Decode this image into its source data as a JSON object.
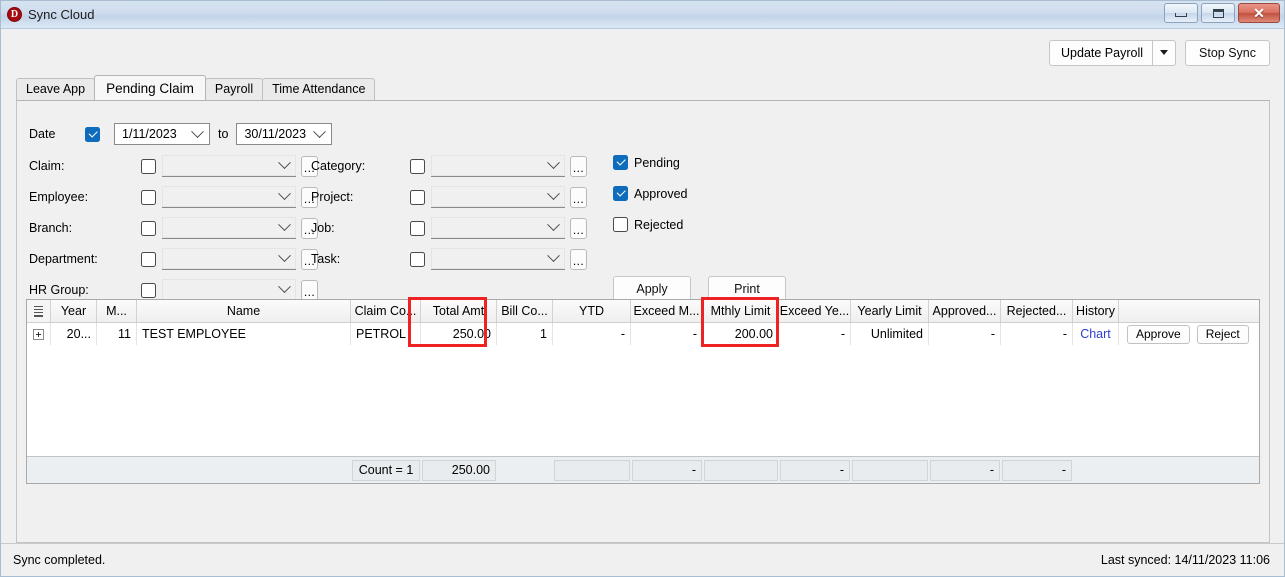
{
  "window": {
    "title": "Sync Cloud",
    "logo_letter": "D",
    "controls": [
      {
        "name": "minimize",
        "label": "Minimize"
      },
      {
        "name": "maximize",
        "label": "Maximize"
      },
      {
        "name": "close",
        "label": "✕"
      }
    ]
  },
  "toolbar": {
    "update_payroll_label": "Update Payroll",
    "stop_sync_label": "Stop Sync"
  },
  "tabs": [
    {
      "label": "Leave App",
      "active": false
    },
    {
      "label": "Pending Claim",
      "active": true
    },
    {
      "label": "Payroll",
      "active": false
    },
    {
      "label": "Time Attendance",
      "active": false
    }
  ],
  "filters": {
    "date": {
      "label": "Date",
      "checked": true,
      "from": "1/11/2023",
      "to_label": "to",
      "to": "30/11/2023"
    },
    "left_column": [
      {
        "label": "Claim:",
        "checked": false,
        "value": "",
        "has_browse": true
      },
      {
        "label": "Employee:",
        "checked": false,
        "value": "",
        "has_browse": true
      },
      {
        "label": "Branch:",
        "checked": false,
        "value": "",
        "has_browse": true
      },
      {
        "label": "Department:",
        "checked": false,
        "value": "",
        "has_browse": true
      },
      {
        "label": "HR Group:",
        "checked": false,
        "value": "",
        "has_browse": true
      }
    ],
    "right_column": [
      {
        "label": "Category:",
        "checked": false,
        "value": "",
        "has_browse": true
      },
      {
        "label": "Project:",
        "checked": false,
        "value": "",
        "has_browse": true
      },
      {
        "label": "Job:",
        "checked": false,
        "value": "",
        "has_browse": true
      },
      {
        "label": "Task:",
        "checked": false,
        "value": "",
        "has_browse": true
      }
    ],
    "status": [
      {
        "label": "Pending",
        "checked": true
      },
      {
        "label": "Approved",
        "checked": true
      },
      {
        "label": "Rejected",
        "checked": false
      }
    ],
    "apply_label": "Apply",
    "print_label": "Print"
  },
  "grid": {
    "columns": [
      {
        "key": "year",
        "label": "Year"
      },
      {
        "key": "month",
        "label": "M..."
      },
      {
        "key": "name",
        "label": "Name"
      },
      {
        "key": "claim_code",
        "label": "Claim Co..."
      },
      {
        "key": "total_amt",
        "label": "Total Amt"
      },
      {
        "key": "bill_count",
        "label": "Bill Co..."
      },
      {
        "key": "ytd",
        "label": "YTD"
      },
      {
        "key": "exceed_mthly",
        "label": "Exceed M..."
      },
      {
        "key": "mthly_limit",
        "label": "Mthly Limit"
      },
      {
        "key": "exceed_yearly",
        "label": "Exceed Ye..."
      },
      {
        "key": "yearly_limit",
        "label": "Yearly Limit"
      },
      {
        "key": "approved",
        "label": "Approved..."
      },
      {
        "key": "rejected",
        "label": "Rejected..."
      },
      {
        "key": "history",
        "label": "History"
      },
      {
        "key": "actions",
        "label": ""
      }
    ],
    "rows": [
      {
        "year": "20...",
        "month": "11",
        "name": "TEST EMPLOYEE",
        "claim_code": "PETROL",
        "total_amt": "250.00",
        "bill_count": "1",
        "ytd": "-",
        "exceed_mthly": "-",
        "mthly_limit": "200.00",
        "exceed_yearly": "-",
        "yearly_limit": "Unlimited",
        "approved": "-",
        "rejected": "-",
        "history_link": "Chart",
        "approve_label": "Approve",
        "reject_label": "Reject"
      }
    ],
    "summary": {
      "count": "Count = 1",
      "total_amt": "250.00",
      "exceed_mthly": "-",
      "mthly_limit": "",
      "exceed_yearly": "-",
      "yearly_limit": "",
      "approved": "-",
      "rejected": "-"
    },
    "highlight_color": "#ee2222",
    "link_color": "#2f3fd4"
  },
  "statusbar": {
    "message": "Sync completed.",
    "last_synced": "Last synced: 14/11/2023 11:06"
  }
}
